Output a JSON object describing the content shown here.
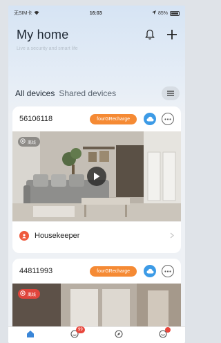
{
  "status_bar": {
    "carrier": "无SIM卡",
    "time": "16:03",
    "battery": "85%"
  },
  "header": {
    "title": "My home",
    "subtitle": "Live a security and smart life"
  },
  "tabs": [
    {
      "label": "All devices",
      "active": true
    },
    {
      "label": "Shared devices",
      "active": false
    }
  ],
  "devices": [
    {
      "id": "56106118",
      "recharge_label": "fourGRecharge",
      "cam_tag": "离线",
      "footer_label": "Housekeeper"
    },
    {
      "id": "44811993",
      "recharge_label": "fourGRecharge",
      "cam_tag": "离线"
    }
  ],
  "tabbar": {
    "badge_count": "99"
  },
  "colors": {
    "accent_orange": "#f58a34",
    "cloud_blue": "#3d9be6",
    "badge_red": "#e8473d"
  }
}
